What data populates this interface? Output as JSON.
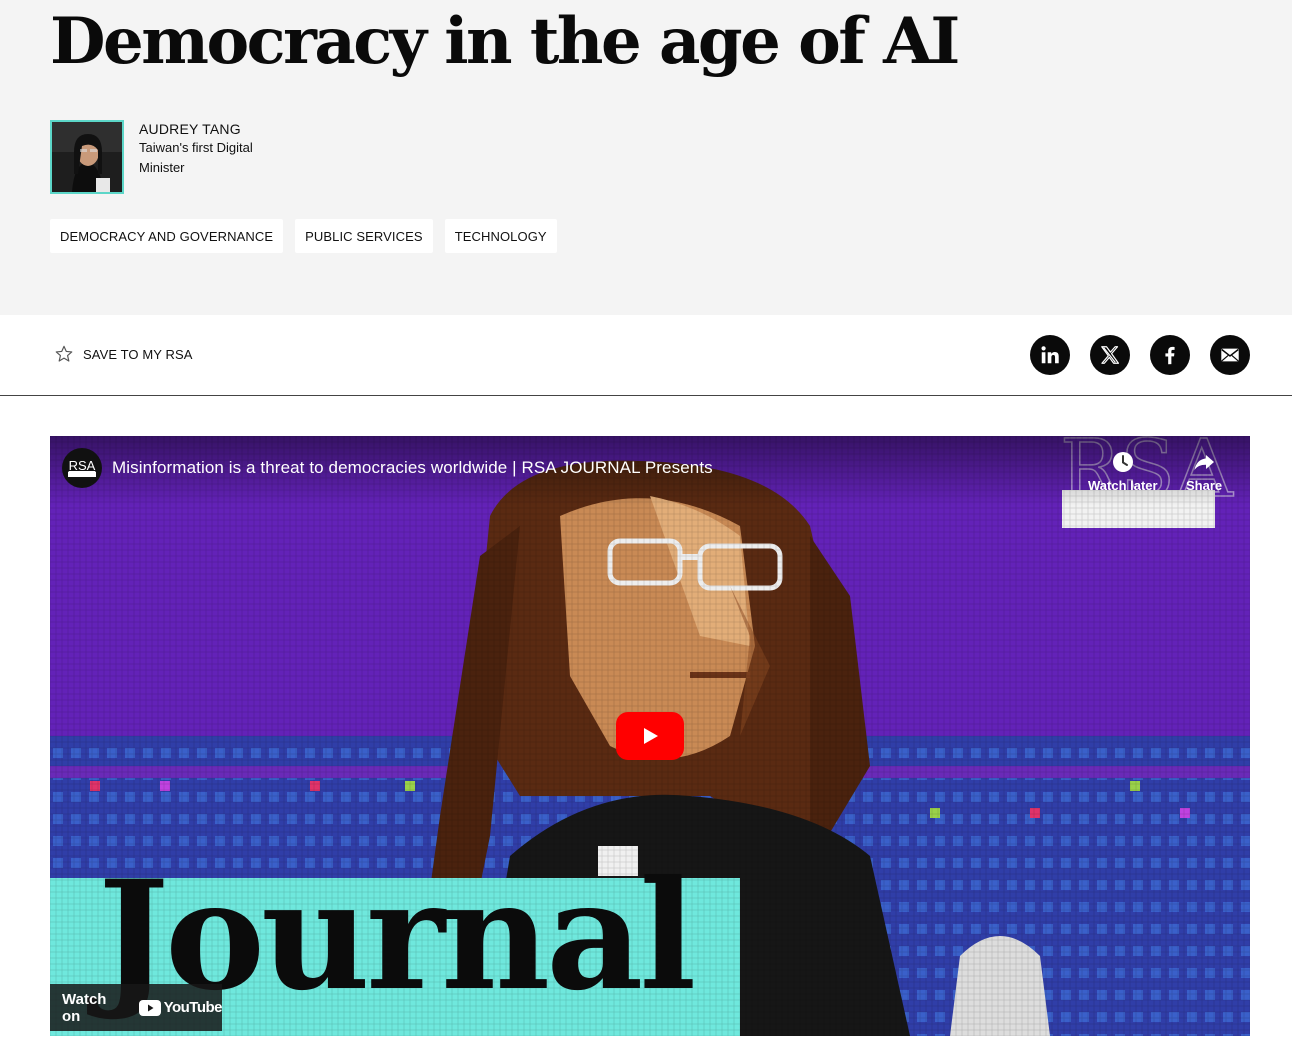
{
  "article": {
    "title": "Democracy in the age of AI"
  },
  "author": {
    "name": "AUDREY TANG",
    "role": "Taiwan's first Digital Minister"
  },
  "tags": [
    "DEMOCRACY AND GOVERNANCE",
    "PUBLIC SERVICES",
    "TECHNOLOGY"
  ],
  "actions": {
    "save_label": "SAVE TO MY RSA",
    "share": [
      "linkedin-icon",
      "x-icon",
      "facebook-icon",
      "email-icon"
    ]
  },
  "video": {
    "channel_logo_text": "RSA",
    "title": "Misinformation is a threat to democracies worldwide | RSA JOURNAL Presents",
    "watch_later_label": "Watch later",
    "share_label": "Share",
    "watch_on_label": "Watch on",
    "youtube_label": "YouTube",
    "thumbnail_word": "Journal",
    "thumbnail_brand": "RSA"
  },
  "colors": {
    "hero_bg": "#f4f4f4",
    "accent_teal": "#6fe8dd",
    "video_purple": "#5a1fa8",
    "youtube_red": "#ff0000"
  }
}
